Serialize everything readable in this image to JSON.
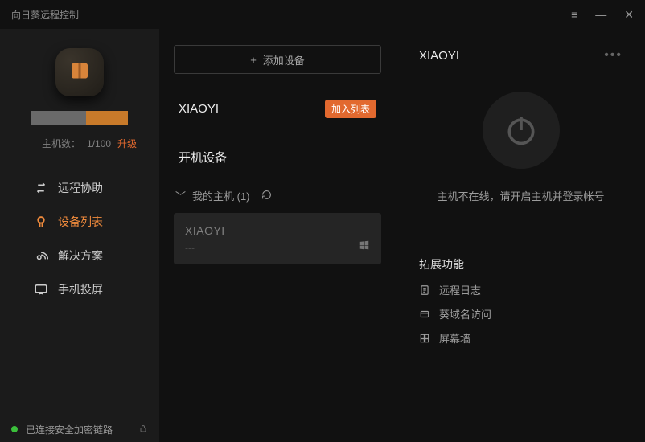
{
  "titlebar": {
    "title": "向日葵远程控制"
  },
  "sidebar": {
    "host_count_label": "主机数：",
    "host_count_value": "1/100",
    "upgrade_label": "升级",
    "nav": {
      "remote_assist": "远程协助",
      "device_list": "设备列表",
      "solutions": "解决方案",
      "phone_cast": "手机投屏"
    },
    "status_text": "已连接安全加密链路"
  },
  "center": {
    "add_device_label": "添加设备",
    "matched_device_name": "XIAOYI",
    "join_label": "加入列表",
    "powered_on_section": "开机设备",
    "group_label": "我的主机 (1)",
    "card": {
      "name": "XIAOYI",
      "sub": "---"
    }
  },
  "right": {
    "title": "XIAOYI",
    "offline_msg": "主机不在线，请开启主机并登录帐号",
    "extensions_header": "拓展功能",
    "extensions": {
      "remote_log": "远程日志",
      "domain_access": "葵域名访问",
      "screen_wall": "屏幕墙"
    }
  }
}
